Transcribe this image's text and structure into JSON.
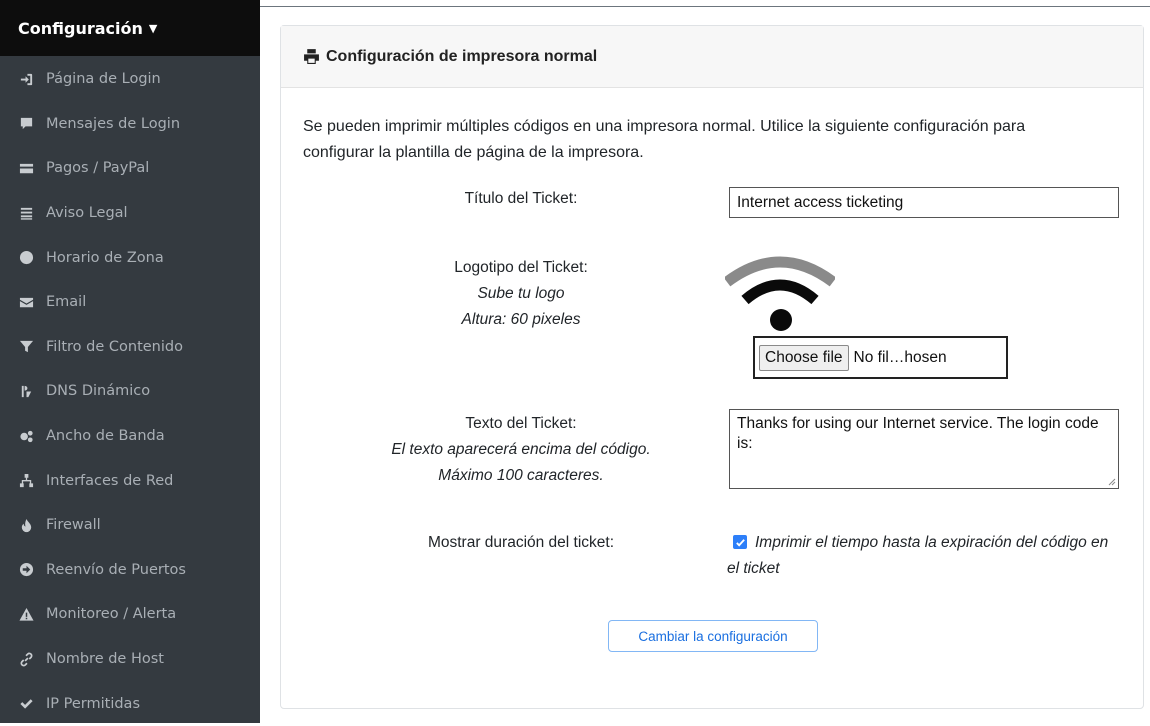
{
  "sidebar": {
    "title": "Configuración",
    "items": [
      {
        "label": "Página de Login",
        "icon": "sign-in-icon"
      },
      {
        "label": "Mensajes de Login",
        "icon": "comment-icon"
      },
      {
        "label": "Pagos / PayPal",
        "icon": "credit-card-icon"
      },
      {
        "label": "Aviso Legal",
        "icon": "list-icon"
      },
      {
        "label": "Horario de Zona",
        "icon": "clock-icon"
      },
      {
        "label": "Email",
        "icon": "envelope-icon"
      },
      {
        "label": "Filtro de Contenido",
        "icon": "filter-icon"
      },
      {
        "label": "DNS Dinámico",
        "icon": "dns-icon"
      },
      {
        "label": "Ancho de Banda",
        "icon": "cogs-icon"
      },
      {
        "label": "Interfaces de Red",
        "icon": "network-icon"
      },
      {
        "label": "Firewall",
        "icon": "fire-icon"
      },
      {
        "label": "Reenvío de Puertos",
        "icon": "arrow-circle-icon"
      },
      {
        "label": "Monitoreo / Alerta",
        "icon": "warning-icon"
      },
      {
        "label": "Nombre de Host",
        "icon": "link-icon"
      },
      {
        "label": "IP Permitidas",
        "icon": "check-icon"
      }
    ]
  },
  "card": {
    "header_icon": "print-icon",
    "title": "Configuración de impresora normal",
    "description": "Se pueden imprimir múltiples códigos en una impresora normal. Utilice la siguiente configuración para configurar la plantilla de página de la impresora."
  },
  "form": {
    "ticket_title_label": "Título del Ticket:",
    "ticket_title_value": "Internet access ticketing",
    "logo_label": "Logotipo del Ticket:",
    "logo_hint1": "Sube tu logo",
    "logo_hint2": "Altura: 60 pixeles",
    "logo_icon": "wifi-icon",
    "choose_file_label": "Choose file",
    "file_status": "No fil…hosen",
    "ticket_text_label": "Texto del Ticket:",
    "ticket_text_hint1": "El texto aparecerá encima del código.",
    "ticket_text_hint2": "Máximo 100 caracteres.",
    "ticket_text_value": "Thanks for using our Internet service. The login code is:",
    "duration_label": "Mostrar duración del ticket:",
    "duration_checked": true,
    "duration_text": "Imprimir el tiempo hasta la expiración del código en el ticket",
    "submit_label": "Cambiar la configuración"
  },
  "colors": {
    "sidebar_bg": "#343a40",
    "sidebar_header_bg": "#0d0d0d",
    "accent": "#2d7ff9",
    "button_text": "#1a6fe0"
  }
}
